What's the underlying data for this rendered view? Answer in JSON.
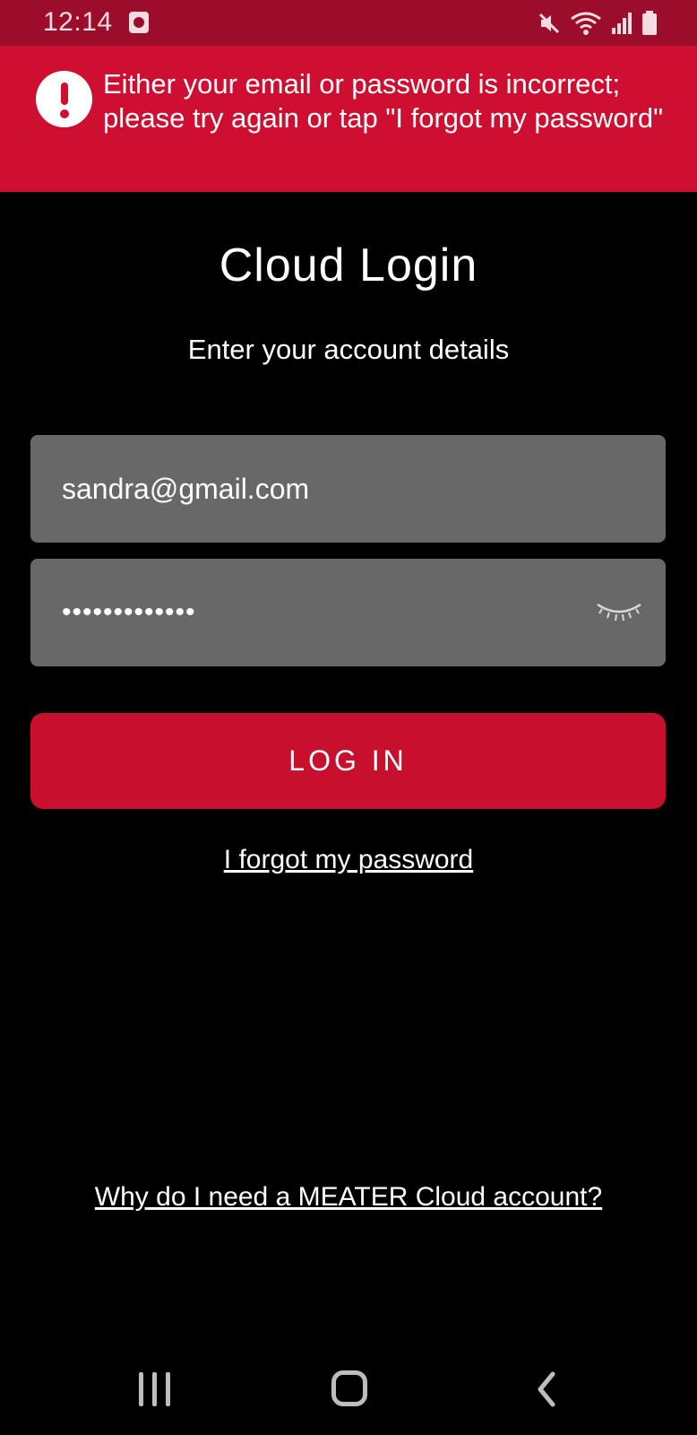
{
  "status_bar": {
    "time": "12:14",
    "icons": [
      "notification-icon",
      "mute-icon",
      "wifi-icon",
      "signal-icon",
      "battery-icon"
    ]
  },
  "error_banner": {
    "icon": "exclamation-icon",
    "message": "Either your email or password is incorrect; please try again or tap \"I forgot my password\"",
    "color": "#cf0f31"
  },
  "login": {
    "title": "Cloud Login",
    "subtitle": "Enter your account details",
    "email_value": "sandra@gmail.com",
    "password_mask": "•••••••••••••",
    "show_password_icon": "eye-closed-icon",
    "login_label": "LOG IN",
    "forgot_label": "I forgot my password",
    "why_label": "Why do I need a MEATER Cloud account?"
  },
  "colors": {
    "status_bar": "#9c0c2b",
    "accent": "#c8102e",
    "field_bg": "#686868",
    "background": "#000000"
  },
  "nav_bar": {
    "buttons": [
      "recents-icon",
      "home-icon",
      "back-icon"
    ]
  }
}
